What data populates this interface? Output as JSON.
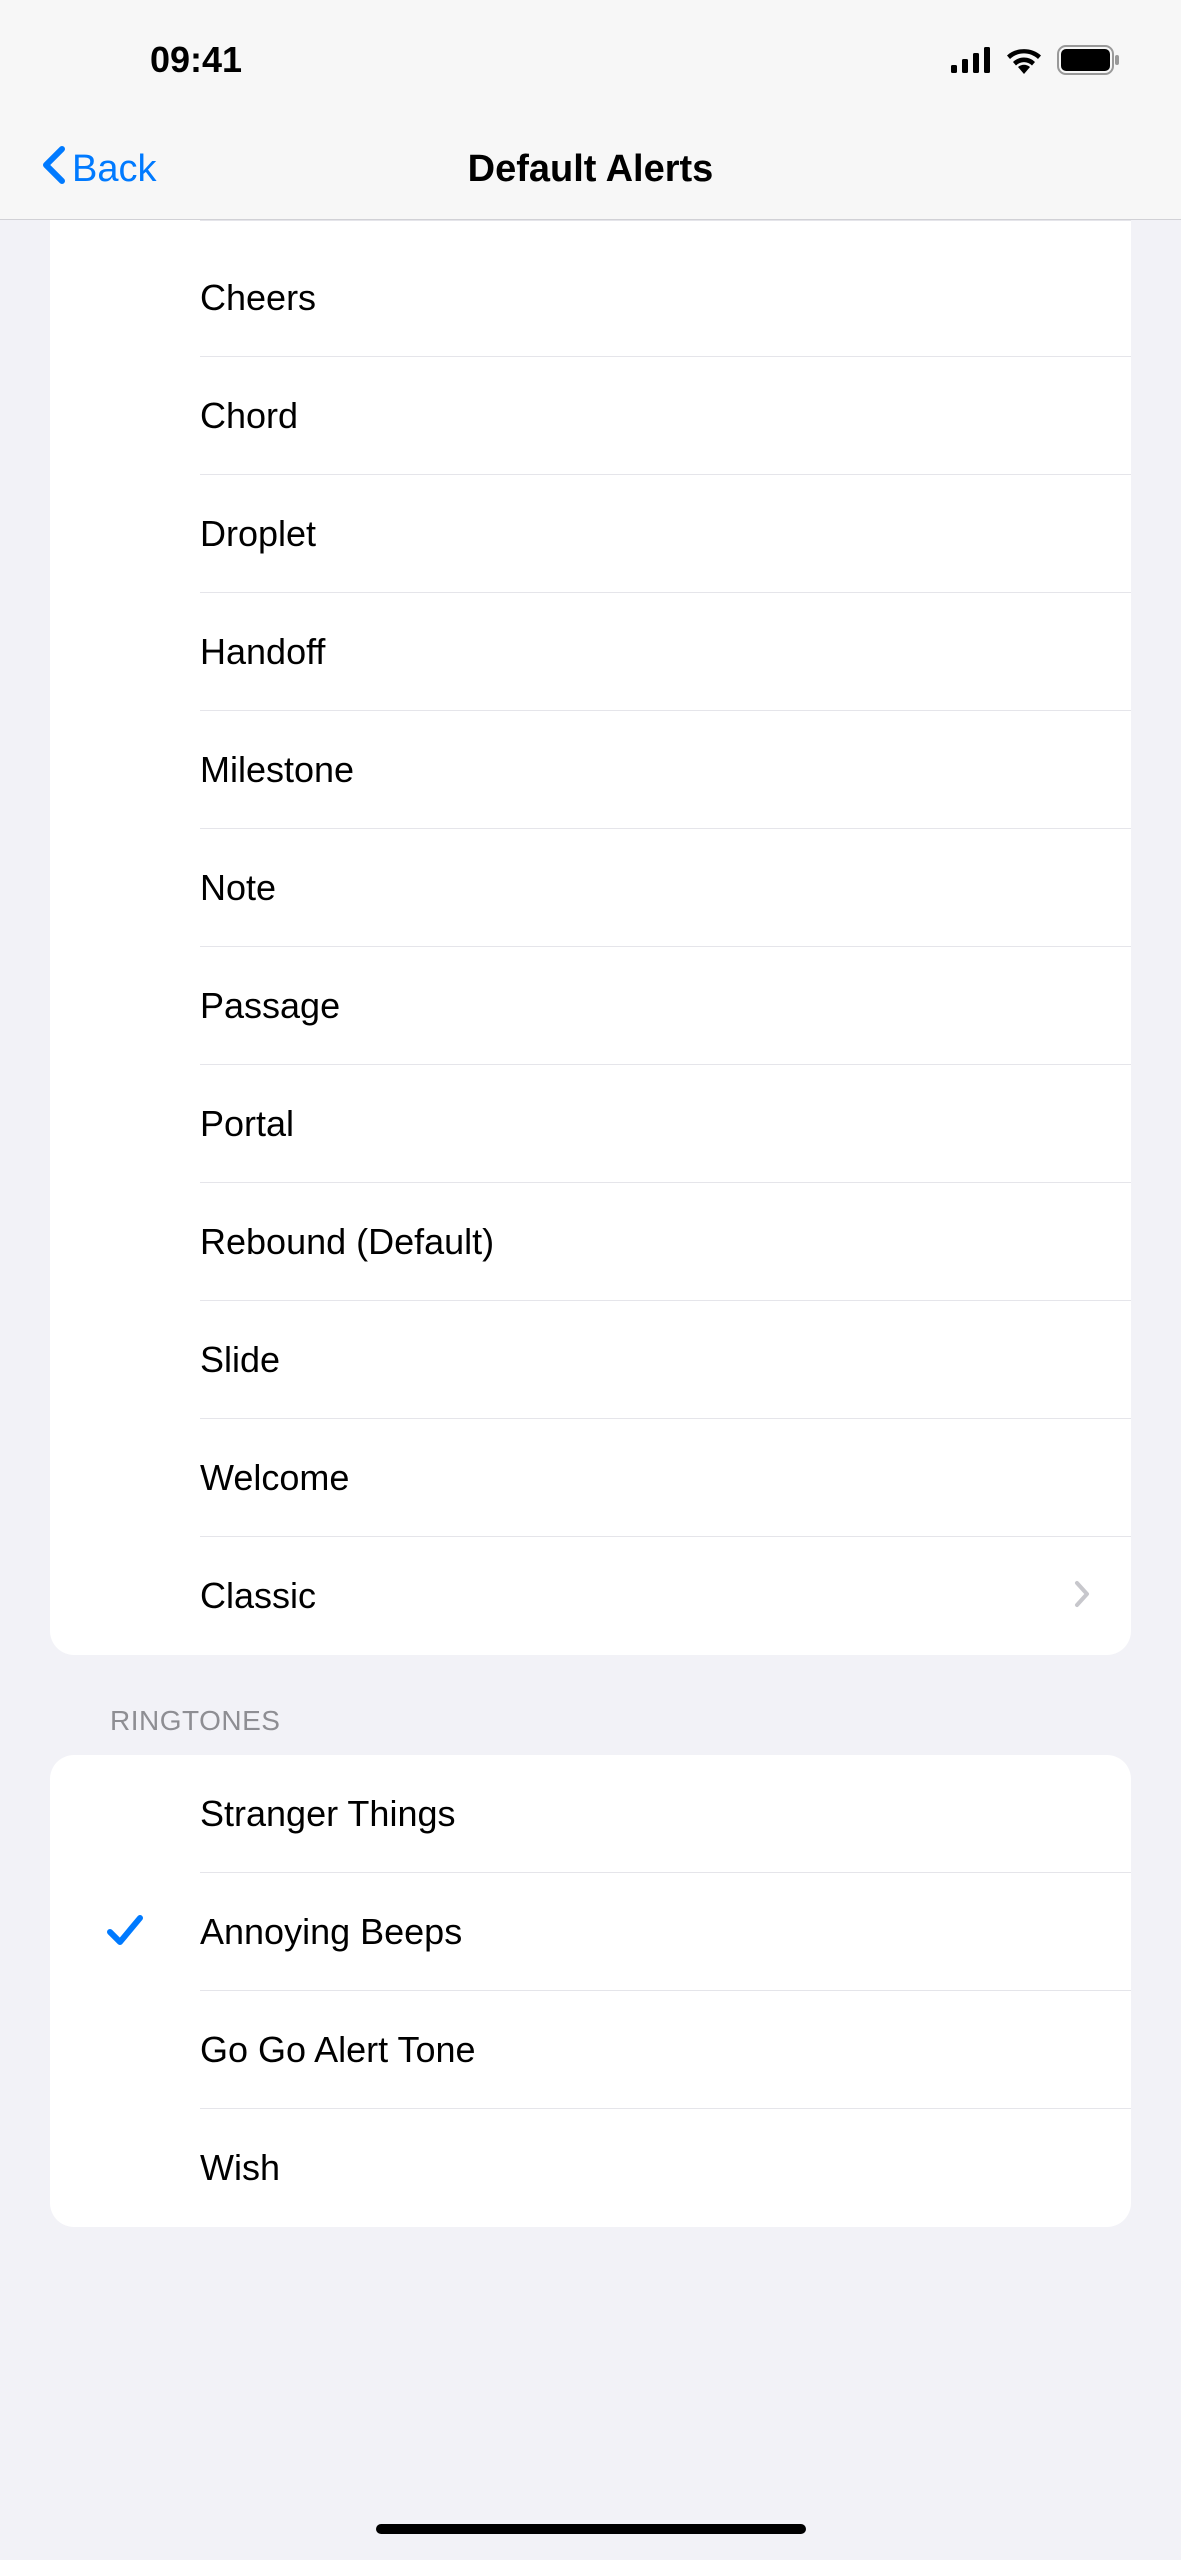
{
  "status": {
    "time": "09:41"
  },
  "nav": {
    "back_label": "Back",
    "title": "Default Alerts"
  },
  "alert_tones": [
    {
      "label": "Cheers",
      "selected": false,
      "disclosure": false
    },
    {
      "label": "Chord",
      "selected": false,
      "disclosure": false
    },
    {
      "label": "Droplet",
      "selected": false,
      "disclosure": false
    },
    {
      "label": "Handoff",
      "selected": false,
      "disclosure": false
    },
    {
      "label": "Milestone",
      "selected": false,
      "disclosure": false
    },
    {
      "label": "Note",
      "selected": false,
      "disclosure": false
    },
    {
      "label": "Passage",
      "selected": false,
      "disclosure": false
    },
    {
      "label": "Portal",
      "selected": false,
      "disclosure": false
    },
    {
      "label": "Rebound (Default)",
      "selected": false,
      "disclosure": false
    },
    {
      "label": "Slide",
      "selected": false,
      "disclosure": false
    },
    {
      "label": "Welcome",
      "selected": false,
      "disclosure": false
    },
    {
      "label": "Classic",
      "selected": false,
      "disclosure": true
    }
  ],
  "sections": {
    "ringtones_header": "RINGTONES"
  },
  "ringtones": [
    {
      "label": "Stranger Things",
      "selected": false,
      "disclosure": false
    },
    {
      "label": "Annoying Beeps",
      "selected": true,
      "disclosure": false
    },
    {
      "label": "Go Go Alert Tone",
      "selected": false,
      "disclosure": false
    },
    {
      "label": "Wish",
      "selected": false,
      "disclosure": false
    }
  ]
}
